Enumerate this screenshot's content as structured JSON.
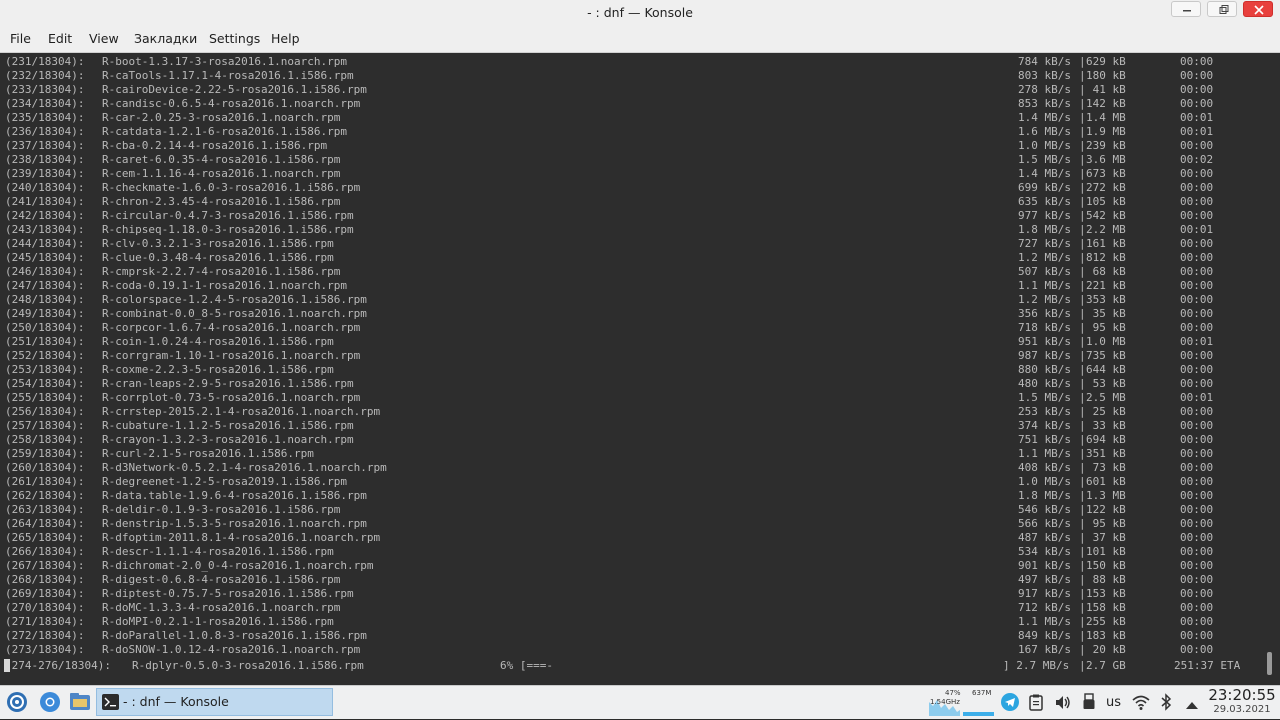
{
  "window": {
    "title": "- : dnf — Konsole"
  },
  "menu": [
    "File",
    "Edit",
    "View",
    "Закладки",
    "Settings",
    "Help"
  ],
  "terminal": {
    "lines": [
      {
        "idx": "(231/18304):",
        "pkg": "R-boot-1.3.17-3-rosa2016.1.noarch.rpm",
        "rate": "784 kB/s",
        "size": "629 kB",
        "time": "00:00"
      },
      {
        "idx": "(232/18304):",
        "pkg": "R-caTools-1.17.1-4-rosa2016.1.i586.rpm",
        "rate": "803 kB/s",
        "size": "180 kB",
        "time": "00:00"
      },
      {
        "idx": "(233/18304):",
        "pkg": "R-cairoDevice-2.22-5-rosa2016.1.i586.rpm",
        "rate": "278 kB/s",
        "size": " 41 kB",
        "time": "00:00"
      },
      {
        "idx": "(234/18304):",
        "pkg": "R-candisc-0.6.5-4-rosa2016.1.noarch.rpm",
        "rate": "853 kB/s",
        "size": "142 kB",
        "time": "00:00"
      },
      {
        "idx": "(235/18304):",
        "pkg": "R-car-2.0.25-3-rosa2016.1.noarch.rpm",
        "rate": "1.4 MB/s",
        "size": "1.4 MB",
        "time": "00:01"
      },
      {
        "idx": "(236/18304):",
        "pkg": "R-catdata-1.2.1-6-rosa2016.1.i586.rpm",
        "rate": "1.6 MB/s",
        "size": "1.9 MB",
        "time": "00:01"
      },
      {
        "idx": "(237/18304):",
        "pkg": "R-cba-0.2.14-4-rosa2016.1.i586.rpm",
        "rate": "1.0 MB/s",
        "size": "239 kB",
        "time": "00:00"
      },
      {
        "idx": "(238/18304):",
        "pkg": "R-caret-6.0.35-4-rosa2016.1.i586.rpm",
        "rate": "1.5 MB/s",
        "size": "3.6 MB",
        "time": "00:02"
      },
      {
        "idx": "(239/18304):",
        "pkg": "R-cem-1.1.16-4-rosa2016.1.noarch.rpm",
        "rate": "1.4 MB/s",
        "size": "673 kB",
        "time": "00:00"
      },
      {
        "idx": "(240/18304):",
        "pkg": "R-checkmate-1.6.0-3-rosa2016.1.i586.rpm",
        "rate": "699 kB/s",
        "size": "272 kB",
        "time": "00:00"
      },
      {
        "idx": "(241/18304):",
        "pkg": "R-chron-2.3.45-4-rosa2016.1.i586.rpm",
        "rate": "635 kB/s",
        "size": "105 kB",
        "time": "00:00"
      },
      {
        "idx": "(242/18304):",
        "pkg": "R-circular-0.4.7-3-rosa2016.1.i586.rpm",
        "rate": "977 kB/s",
        "size": "542 kB",
        "time": "00:00"
      },
      {
        "idx": "(243/18304):",
        "pkg": "R-chipseq-1.18.0-3-rosa2016.1.i586.rpm",
        "rate": "1.8 MB/s",
        "size": "2.2 MB",
        "time": "00:01"
      },
      {
        "idx": "(244/18304):",
        "pkg": "R-clv-0.3.2.1-3-rosa2016.1.i586.rpm",
        "rate": "727 kB/s",
        "size": "161 kB",
        "time": "00:00"
      },
      {
        "idx": "(245/18304):",
        "pkg": "R-clue-0.3.48-4-rosa2016.1.i586.rpm",
        "rate": "1.2 MB/s",
        "size": "812 kB",
        "time": "00:00"
      },
      {
        "idx": "(246/18304):",
        "pkg": "R-cmprsk-2.2.7-4-rosa2016.1.i586.rpm",
        "rate": "507 kB/s",
        "size": " 68 kB",
        "time": "00:00"
      },
      {
        "idx": "(247/18304):",
        "pkg": "R-coda-0.19.1-1-rosa2016.1.noarch.rpm",
        "rate": "1.1 MB/s",
        "size": "221 kB",
        "time": "00:00"
      },
      {
        "idx": "(248/18304):",
        "pkg": "R-colorspace-1.2.4-5-rosa2016.1.i586.rpm",
        "rate": "1.2 MB/s",
        "size": "353 kB",
        "time": "00:00"
      },
      {
        "idx": "(249/18304):",
        "pkg": "R-combinat-0.0_8-5-rosa2016.1.noarch.rpm",
        "rate": "356 kB/s",
        "size": " 35 kB",
        "time": "00:00"
      },
      {
        "idx": "(250/18304):",
        "pkg": "R-corpcor-1.6.7-4-rosa2016.1.noarch.rpm",
        "rate": "718 kB/s",
        "size": " 95 kB",
        "time": "00:00"
      },
      {
        "idx": "(251/18304):",
        "pkg": "R-coin-1.0.24-4-rosa2016.1.i586.rpm",
        "rate": "951 kB/s",
        "size": "1.0 MB",
        "time": "00:01"
      },
      {
        "idx": "(252/18304):",
        "pkg": "R-corrgram-1.10-1-rosa2016.1.noarch.rpm",
        "rate": "987 kB/s",
        "size": "735 kB",
        "time": "00:00"
      },
      {
        "idx": "(253/18304):",
        "pkg": "R-coxme-2.2.3-5-rosa2016.1.i586.rpm",
        "rate": "880 kB/s",
        "size": "644 kB",
        "time": "00:00"
      },
      {
        "idx": "(254/18304):",
        "pkg": "R-cran-leaps-2.9-5-rosa2016.1.i586.rpm",
        "rate": "480 kB/s",
        "size": " 53 kB",
        "time": "00:00"
      },
      {
        "idx": "(255/18304):",
        "pkg": "R-corrplot-0.73-5-rosa2016.1.noarch.rpm",
        "rate": "1.5 MB/s",
        "size": "2.5 MB",
        "time": "00:01"
      },
      {
        "idx": "(256/18304):",
        "pkg": "R-crrstep-2015.2.1-4-rosa2016.1.noarch.rpm",
        "rate": "253 kB/s",
        "size": " 25 kB",
        "time": "00:00"
      },
      {
        "idx": "(257/18304):",
        "pkg": "R-cubature-1.1.2-5-rosa2016.1.i586.rpm",
        "rate": "374 kB/s",
        "size": " 33 kB",
        "time": "00:00"
      },
      {
        "idx": "(258/18304):",
        "pkg": "R-crayon-1.3.2-3-rosa2016.1.noarch.rpm",
        "rate": "751 kB/s",
        "size": "694 kB",
        "time": "00:00"
      },
      {
        "idx": "(259/18304):",
        "pkg": "R-curl-2.1-5-rosa2016.1.i586.rpm",
        "rate": "1.1 MB/s",
        "size": "351 kB",
        "time": "00:00"
      },
      {
        "idx": "(260/18304):",
        "pkg": "R-d3Network-0.5.2.1-4-rosa2016.1.noarch.rpm",
        "rate": "408 kB/s",
        "size": " 73 kB",
        "time": "00:00"
      },
      {
        "idx": "(261/18304):",
        "pkg": "R-degreenet-1.2-5-rosa2019.1.i586.rpm",
        "rate": "1.0 MB/s",
        "size": "601 kB",
        "time": "00:00"
      },
      {
        "idx": "(262/18304):",
        "pkg": "R-data.table-1.9.6-4-rosa2016.1.i586.rpm",
        "rate": "1.8 MB/s",
        "size": "1.3 MB",
        "time": "00:00"
      },
      {
        "idx": "(263/18304):",
        "pkg": "R-deldir-0.1.9-3-rosa2016.1.i586.rpm",
        "rate": "546 kB/s",
        "size": "122 kB",
        "time": "00:00"
      },
      {
        "idx": "(264/18304):",
        "pkg": "R-denstrip-1.5.3-5-rosa2016.1.noarch.rpm",
        "rate": "566 kB/s",
        "size": " 95 kB",
        "time": "00:00"
      },
      {
        "idx": "(265/18304):",
        "pkg": "R-dfoptim-2011.8.1-4-rosa2016.1.noarch.rpm",
        "rate": "487 kB/s",
        "size": " 37 kB",
        "time": "00:00"
      },
      {
        "idx": "(266/18304):",
        "pkg": "R-descr-1.1.1-4-rosa2016.1.i586.rpm",
        "rate": "534 kB/s",
        "size": "101 kB",
        "time": "00:00"
      },
      {
        "idx": "(267/18304):",
        "pkg": "R-dichromat-2.0_0-4-rosa2016.1.noarch.rpm",
        "rate": "901 kB/s",
        "size": "150 kB",
        "time": "00:00"
      },
      {
        "idx": "(268/18304):",
        "pkg": "R-digest-0.6.8-4-rosa2016.1.i586.rpm",
        "rate": "497 kB/s",
        "size": " 88 kB",
        "time": "00:00"
      },
      {
        "idx": "(269/18304):",
        "pkg": "R-diptest-0.75.7-5-rosa2016.1.i586.rpm",
        "rate": "917 kB/s",
        "size": "153 kB",
        "time": "00:00"
      },
      {
        "idx": "(270/18304):",
        "pkg": "R-doMC-1.3.3-4-rosa2016.1.noarch.rpm",
        "rate": "712 kB/s",
        "size": "158 kB",
        "time": "00:00"
      },
      {
        "idx": "(271/18304):",
        "pkg": "R-doMPI-0.2.1-1-rosa2016.1.i586.rpm",
        "rate": "1.1 MB/s",
        "size": "255 kB",
        "time": "00:00"
      },
      {
        "idx": "(272/18304):",
        "pkg": "R-doParallel-1.0.8-3-rosa2016.1.i586.rpm",
        "rate": "849 kB/s",
        "size": "183 kB",
        "time": "00:00"
      },
      {
        "idx": "(273/18304):",
        "pkg": "R-doSNOW-1.0.12-4-rosa2016.1.noarch.rpm",
        "rate": "167 kB/s",
        "size": " 20 kB",
        "time": "00:00"
      }
    ],
    "progress": {
      "idx": "(274-276/18304):",
      "pkg": "R-dplyr-0.5.0-3-rosa2016.1.i586.rpm",
      "bar": "6% [===-",
      "rate": "] 2.7 MB/s",
      "size": "2.7 GB",
      "eta": "251:37 ETA"
    }
  },
  "taskbar": {
    "task_label": "- : dnf — Konsole",
    "cpu_percent": "47%",
    "cpu_freq": "1.54GHz",
    "mem": "637M",
    "keyboard_layout": "us",
    "clock_time": "23:20:55",
    "clock_date": "29.03.2021"
  },
  "icons": {
    "start": "rosa-launcher-icon",
    "browser": "chromium-icon",
    "files": "file-manager-icon",
    "konsole": "konsole-icon",
    "telegram": "telegram-icon",
    "clipboard": "clipboard-icon",
    "volume": "speaker-icon",
    "usb": "usb-icon",
    "wifi": "wifi-icon",
    "bluetooth": "bluetooth-icon",
    "expand": "chevron-up-icon"
  },
  "colors": {
    "terminal_bg": "#2d2d2d",
    "terminal_fg": "#b9b9b9",
    "close_button": "#e8403d",
    "task_active": "#bfd9ef"
  }
}
